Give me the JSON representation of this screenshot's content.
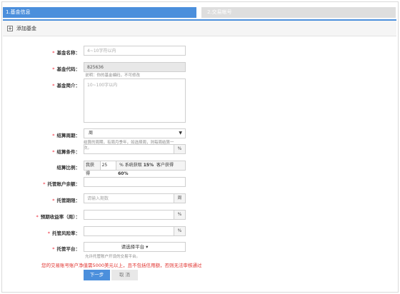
{
  "steps": {
    "step1": "1.基金信息",
    "step2": "2.交易帐号"
  },
  "toolbar": {
    "add_label": "添加基金",
    "add_icon": "+"
  },
  "form": {
    "fund_name": {
      "label": "基金名称：",
      "placeholder": "4~10字符以内",
      "value": ""
    },
    "fund_code": {
      "label": "基金代码：",
      "value": "825636",
      "hint": "说明：你的基金编码，不可修改"
    },
    "fund_intro": {
      "label": "基金简介：",
      "placeholder": "10~100字以内"
    },
    "settle_cycle": {
      "label": "结算周期：",
      "value": "周",
      "caret": "▼"
    },
    "settle_condition": {
      "label": "结算条件：",
      "hint_line1": "结算的周期，有周月季年，如选择周，则每周结算一",
      "hint_line2": "次。",
      "unit": "%"
    },
    "settle_ratio": {
      "label": "结算比例：",
      "prefix": "我获得",
      "value": "25",
      "suffix1": "% 系统获取",
      "system_pct": "15%",
      "suffix2": " 客户获得",
      "client_pct": "60%"
    },
    "custody_balance": {
      "label": "托管账户余额：",
      "value": ""
    },
    "custody_period": {
      "label": "托管期限：",
      "placeholder": "请输入期数",
      "unit": "周"
    },
    "expected_return": {
      "label": "预期收益率（周）：",
      "unit": "%"
    },
    "custody_risk": {
      "label": "托管风险率：",
      "unit": "%"
    },
    "custody_platform": {
      "label": "托管平台：",
      "value": "请选择平台",
      "caret": "▾",
      "hint": "允许托管账户开设的交易平台。"
    }
  },
  "warning": "您的交易账号账户净值需5000美元以上，且不包括信用额，否则无法审核通过",
  "buttons": {
    "next": "下一步",
    "cancel": "取 消"
  }
}
